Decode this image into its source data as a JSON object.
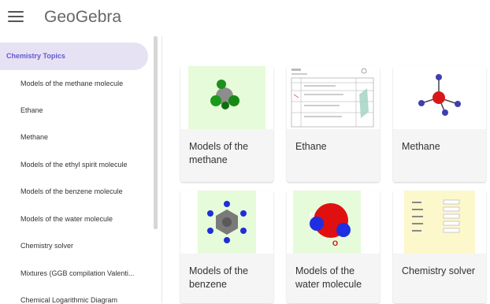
{
  "app": {
    "logo_text": "GeoGebra",
    "menu_icon": "hamburger-menu-icon"
  },
  "sidebar": {
    "title": "Chemistry Topics",
    "items": [
      "Models of the methane molecule",
      "Ethane",
      "Methane",
      "Models of the ethyl spirit molecule",
      "Models of the benzene molecule",
      "Models of the water molecule",
      "Chemistry solver",
      "Mixtures (GGB compilation Valenti...",
      "Chemical Logarithmic Diagram"
    ]
  },
  "cards": [
    {
      "title": "Models of the methane",
      "thumb": "methane-model-thumbnail"
    },
    {
      "title": "Ethane",
      "thumb": "ethane-worksheet-thumbnail"
    },
    {
      "title": "Methane",
      "thumb": "methane-molecule-thumbnail"
    },
    {
      "title": "Models of the benzene",
      "thumb": "benzene-model-thumbnail"
    },
    {
      "title": "Models of the water molecule",
      "thumb": "water-molecule-thumbnail"
    },
    {
      "title": "Chemistry solver",
      "thumb": "chemistry-solver-thumbnail"
    }
  ],
  "colors": {
    "accent": "#6557d2",
    "selected_bg": "#e6e2f3",
    "card_bg": "#f5f5f5"
  }
}
